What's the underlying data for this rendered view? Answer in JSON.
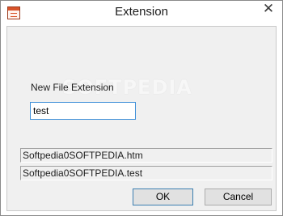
{
  "window": {
    "title": "Extension",
    "close_glyph": "✕",
    "icon": "app-document-icon"
  },
  "main": {
    "watermark": "SOFTPEDIA",
    "field_label": "New File Extension",
    "extension_value": "test"
  },
  "paths": {
    "original": "Softpedia0SOFTPEDIA.htm",
    "renamed": "Softpedia0SOFTPEDIA.test"
  },
  "buttons": {
    "ok_label": "OK",
    "cancel_label": "Cancel"
  },
  "colors": {
    "focus_border": "#3f8fd8",
    "icon_accent": "#d9542a"
  }
}
